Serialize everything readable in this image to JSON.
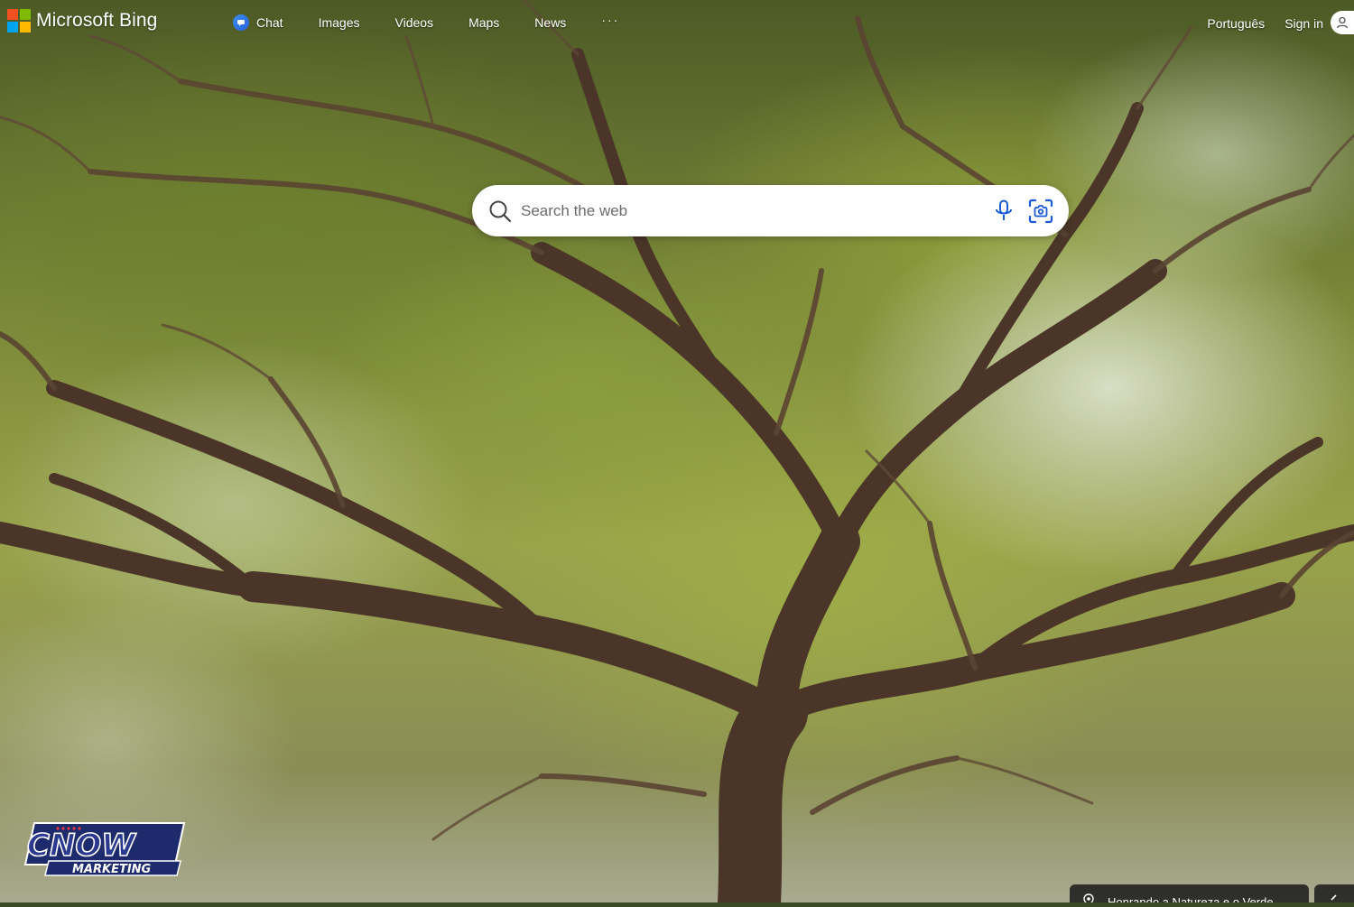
{
  "brand": {
    "name": "Microsoft Bing",
    "square_colors": [
      "#f25022",
      "#7fba00",
      "#00a4ef",
      "#ffb900"
    ]
  },
  "nav": {
    "items": [
      {
        "label": "Chat"
      },
      {
        "label": "Images"
      },
      {
        "label": "Videos"
      },
      {
        "label": "Maps"
      },
      {
        "label": "News"
      }
    ],
    "more": "···"
  },
  "header_right": {
    "language": "Português",
    "sign_in": "Sign in"
  },
  "search": {
    "placeholder": "Search the web",
    "value": "",
    "icons": [
      "search-icon",
      "microphone-icon",
      "visual-search-icon"
    ],
    "accent": "#1a5ad7"
  },
  "watermark": {
    "line1": "CNOW",
    "line2": "MARKETING"
  },
  "image_info": {
    "caption": "Honrando a Natureza e o Verde"
  }
}
